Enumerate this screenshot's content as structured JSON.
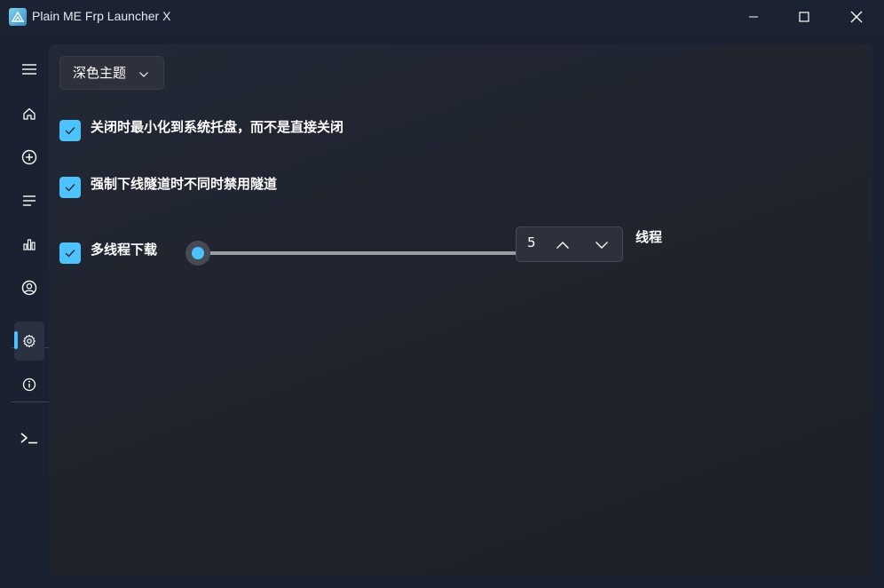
{
  "window": {
    "title": "Plain ME Frp Launcher X",
    "controls": [
      "minimize-icon",
      "maximize-icon",
      "close-icon"
    ]
  },
  "sidebar": {
    "items": [
      {
        "icon": "hamburger-menu-icon"
      },
      {
        "icon": "home-icon"
      },
      {
        "icon": "add-circle-icon"
      },
      {
        "icon": "list-icon"
      },
      {
        "icon": "bar-chart-icon"
      },
      {
        "icon": "user-icon"
      },
      {
        "icon": "settings-icon",
        "active": true
      },
      {
        "icon": "info-icon"
      },
      {
        "icon": "terminal-icon"
      }
    ]
  },
  "settings": {
    "theme": {
      "selected": "深色主题"
    },
    "options": [
      {
        "label": "关闭时最小化到系统托盘，而不是直接关闭",
        "checked": true
      },
      {
        "label": "强制下线隧道时不同时禁用隧道",
        "checked": true
      },
      {
        "label": "多线程下载",
        "checked": true
      }
    ],
    "threads": {
      "value": "5",
      "unit_label": "线程",
      "slider_fraction": 0.0
    }
  },
  "colors": {
    "accent": "#4cc2ff",
    "background": "#1a2131",
    "content_panel": "#202530"
  }
}
